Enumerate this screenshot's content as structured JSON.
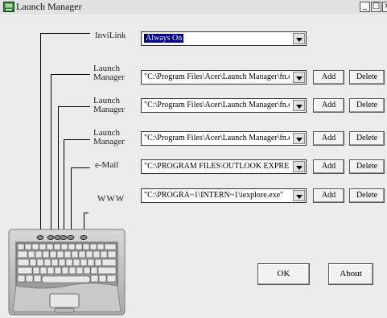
{
  "window": {
    "title": "Launch Manager",
    "min_glyph": "_",
    "max_glyph": "□",
    "close_glyph": "×"
  },
  "rows": [
    {
      "label": "InviLink",
      "value": "Always On",
      "selected": true
    },
    {
      "label": "Launch Manager",
      "value": "\"C:\\Program Files\\Acer\\Launch Manager\\fn.e:",
      "add": "Add",
      "delete": "Delete"
    },
    {
      "label": "Launch Manager",
      "value": "\"C:\\Program Files\\Acer\\Launch Manager\\fn.e:",
      "add": "Add",
      "delete": "Delete"
    },
    {
      "label": "Launch Manager",
      "value": "\"C:\\Program Files\\Acer\\Launch Manager\\fn.e:",
      "add": "Add",
      "delete": "Delete"
    },
    {
      "label": "e-Mail",
      "value": "\"C:\\PROGRAM FILES\\OUTLOOK EXPRES:",
      "add": "Add",
      "delete": "Delete"
    },
    {
      "label": "WWW",
      "value": "\"C:\\PROGRA~1\\INTERN~1\\iexplore.exe\"",
      "add": "Add",
      "delete": "Delete"
    }
  ],
  "buttons": {
    "ok": "OK",
    "about": "About"
  },
  "colors": {
    "selection": "#000080",
    "window_bg": "#ececec"
  }
}
